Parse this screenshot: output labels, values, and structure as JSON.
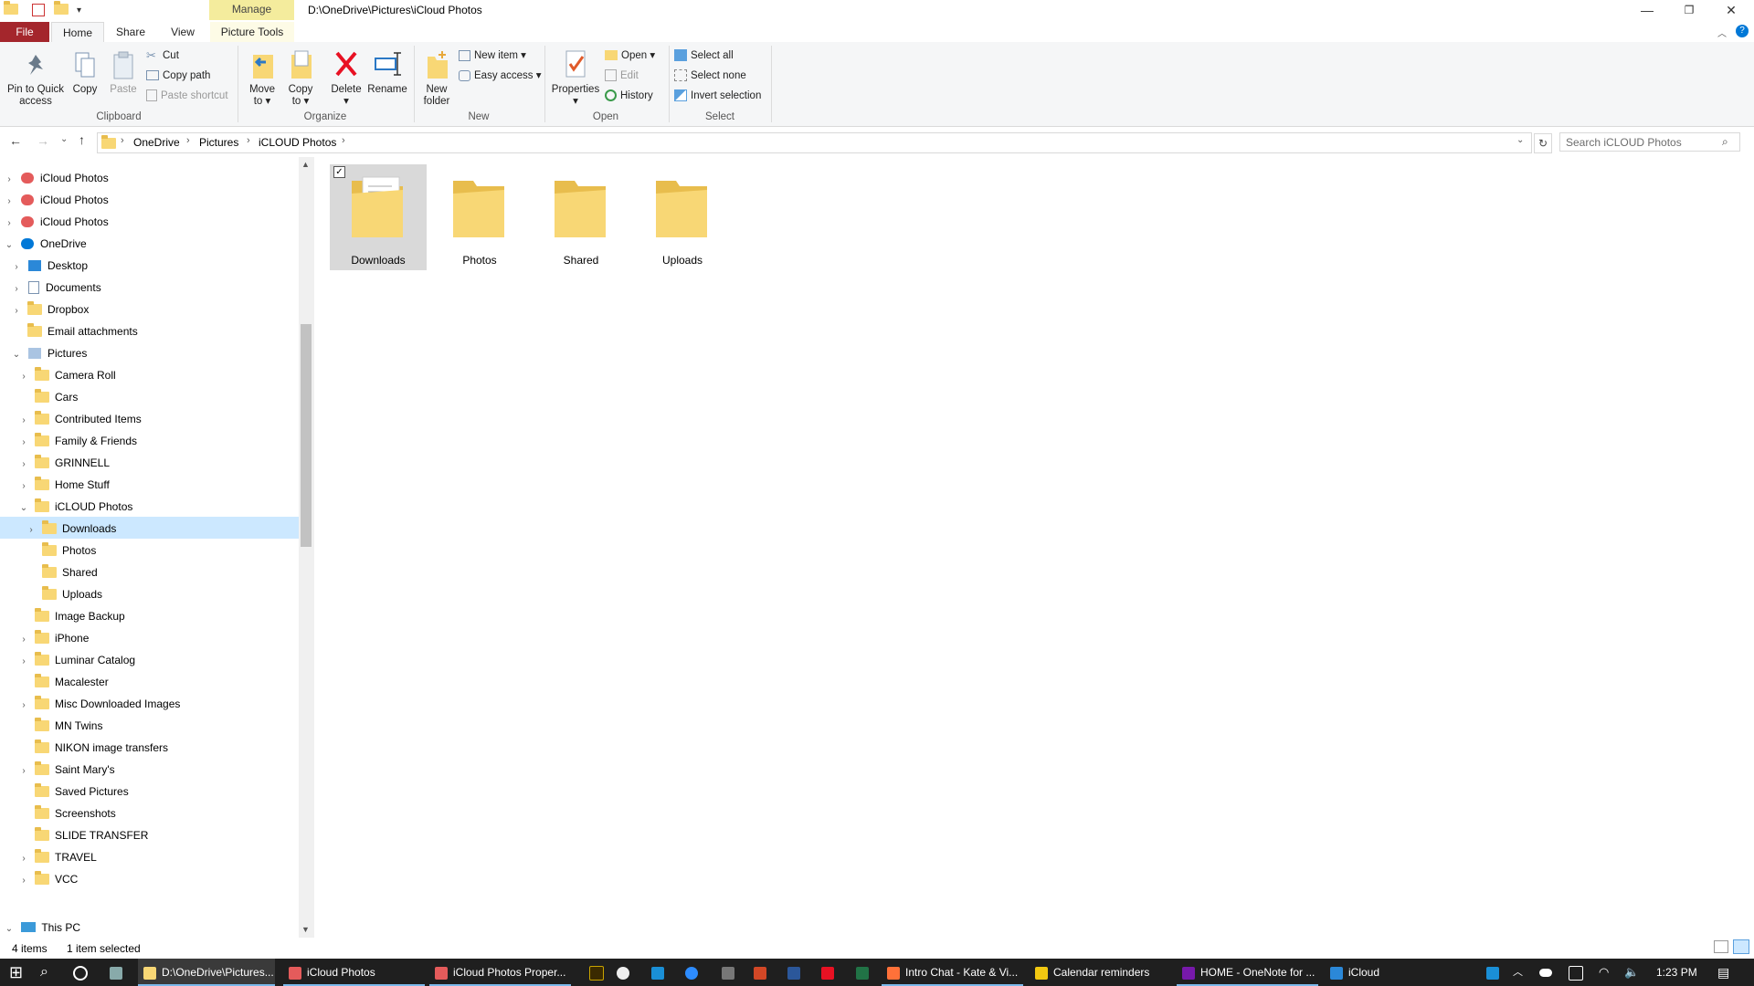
{
  "window": {
    "title": "D:\\OneDrive\\Pictures\\iCloud Photos",
    "contextual_tab": "Manage"
  },
  "ribbon_tabs": [
    "File",
    "Home",
    "Share",
    "View",
    "Picture Tools"
  ],
  "ribbon": {
    "clipboard": {
      "pin": "Pin to Quick access",
      "pin_l1": "Pin to Quick",
      "pin_l2": "access",
      "copy": "Copy",
      "paste": "Paste",
      "cut": "Cut",
      "copy_path": "Copy path",
      "paste_shortcut": "Paste shortcut",
      "group": "Clipboard"
    },
    "organize": {
      "move_l1": "Move",
      "move_l2": "to",
      "copy_l1": "Copy",
      "copy_l2": "to",
      "delete": "Delete",
      "rename": "Rename",
      "group": "Organize"
    },
    "new": {
      "new_folder_l1": "New",
      "new_folder_l2": "folder",
      "new_item": "New item",
      "easy_access": "Easy access",
      "group": "New"
    },
    "open": {
      "properties": "Properties",
      "open": "Open",
      "edit": "Edit",
      "history": "History",
      "group": "Open"
    },
    "select": {
      "select_all": "Select all",
      "select_none": "Select none",
      "invert": "Invert selection",
      "group": "Select"
    }
  },
  "breadcrumb": [
    "OneDrive",
    "Pictures",
    "iCLOUD Photos"
  ],
  "search_placeholder": "Search iCLOUD Photos",
  "nav_tree": [
    {
      "label": "iCloud Photos",
      "level": 0,
      "arrow": "›",
      "icon": "icloud"
    },
    {
      "label": "iCloud Photos",
      "level": 0,
      "arrow": "›",
      "icon": "icloud"
    },
    {
      "label": "iCloud Photos",
      "level": 0,
      "arrow": "›",
      "icon": "icloud"
    },
    {
      "label": "OneDrive",
      "level": 0,
      "arrow": "⌄",
      "icon": "cloud"
    },
    {
      "label": "Desktop",
      "level": 1,
      "arrow": "›",
      "icon": "desktop"
    },
    {
      "label": "Documents",
      "level": 1,
      "arrow": "›",
      "icon": "doc"
    },
    {
      "label": "Dropbox",
      "level": 1,
      "arrow": "›",
      "icon": "folder"
    },
    {
      "label": "Email attachments",
      "level": 1,
      "arrow": "",
      "icon": "folder"
    },
    {
      "label": "Pictures",
      "level": 1,
      "arrow": "⌄",
      "icon": "pictures"
    },
    {
      "label": "Camera Roll",
      "level": 2,
      "arrow": "›",
      "icon": "folder"
    },
    {
      "label": "Cars",
      "level": 2,
      "arrow": "",
      "icon": "folder"
    },
    {
      "label": "Contributed Items",
      "level": 2,
      "arrow": "›",
      "icon": "folder"
    },
    {
      "label": "Family & Friends",
      "level": 2,
      "arrow": "›",
      "icon": "folder"
    },
    {
      "label": "GRINNELL",
      "level": 2,
      "arrow": "›",
      "icon": "folder"
    },
    {
      "label": "Home Stuff",
      "level": 2,
      "arrow": "›",
      "icon": "folder"
    },
    {
      "label": "iCLOUD Photos",
      "level": 2,
      "arrow": "⌄",
      "icon": "folder"
    },
    {
      "label": "Downloads",
      "level": 3,
      "arrow": "›",
      "icon": "folder"
    },
    {
      "label": "Photos",
      "level": 3,
      "arrow": "",
      "icon": "folder"
    },
    {
      "label": "Shared",
      "level": 3,
      "arrow": "",
      "icon": "folder"
    },
    {
      "label": "Uploads",
      "level": 3,
      "arrow": "",
      "icon": "folder"
    },
    {
      "label": "Image Backup",
      "level": 2,
      "arrow": "",
      "icon": "folder"
    },
    {
      "label": "iPhone",
      "level": 2,
      "arrow": "›",
      "icon": "folder"
    },
    {
      "label": "Luminar Catalog",
      "level": 2,
      "arrow": "›",
      "icon": "folder"
    },
    {
      "label": "Macalester",
      "level": 2,
      "arrow": "",
      "icon": "folder"
    },
    {
      "label": "Misc Downloaded Images",
      "level": 2,
      "arrow": "›",
      "icon": "folder"
    },
    {
      "label": "MN Twins",
      "level": 2,
      "arrow": "",
      "icon": "folder"
    },
    {
      "label": "NIKON image transfers",
      "level": 2,
      "arrow": "",
      "icon": "folder"
    },
    {
      "label": "Saint Mary's",
      "level": 2,
      "arrow": "›",
      "icon": "folder"
    },
    {
      "label": "Saved Pictures",
      "level": 2,
      "arrow": "",
      "icon": "folder"
    },
    {
      "label": "Screenshots",
      "level": 2,
      "arrow": "",
      "icon": "folder"
    },
    {
      "label": "SLIDE TRANSFER",
      "level": 2,
      "arrow": "",
      "icon": "folder"
    },
    {
      "label": "TRAVEL",
      "level": 2,
      "arrow": "›",
      "icon": "folder"
    },
    {
      "label": "VCC",
      "level": 2,
      "arrow": "›",
      "icon": "folder"
    }
  ],
  "this_pc": "This PC",
  "files": [
    "Downloads",
    "Photos",
    "Shared",
    "Uploads"
  ],
  "status": {
    "count": "4 items",
    "selected": "1 item selected"
  },
  "taskbar": {
    "apps": [
      "D:\\OneDrive\\Pictures...",
      "iCloud Photos",
      "iCloud Photos Proper...",
      "Intro Chat - Kate & Vi...",
      "Calendar reminders",
      "HOME - OneNote for ...",
      "iCloud"
    ],
    "time": "1:23 PM"
  },
  "colors": {
    "accent": "#0078d7",
    "file_tab": "#a4262c",
    "selection": "#cce8ff",
    "manage_tab": "#f4ec9d",
    "folder": "#f8d775"
  }
}
